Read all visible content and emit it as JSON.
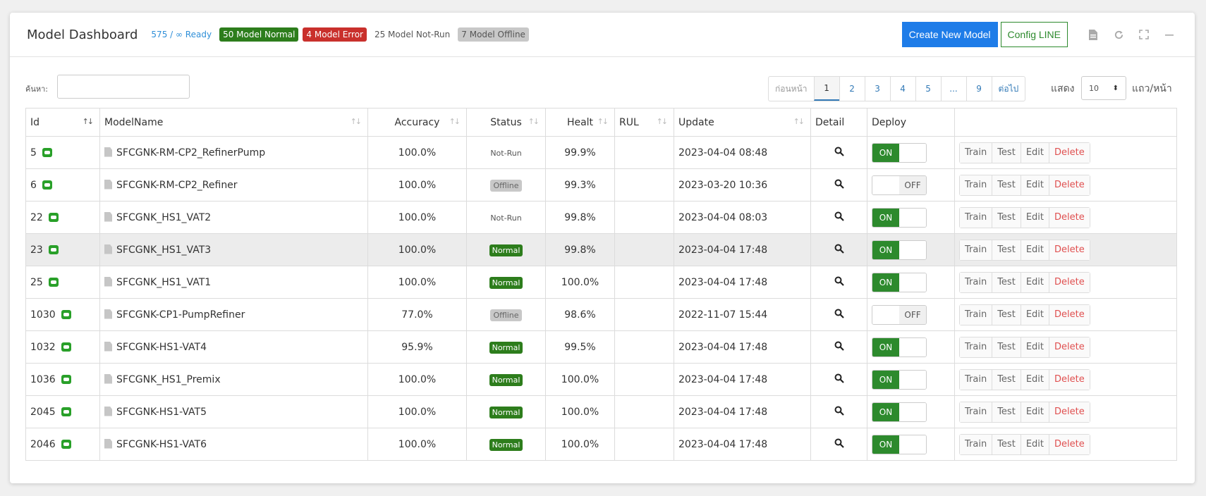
{
  "header": {
    "title": "Model Dashboard",
    "badges": {
      "ready": "575 / ∞ Ready",
      "normal": "50 Model Normal",
      "error": "4 Model Error",
      "notrun": "25 Model Not-Run",
      "offline": "7 Model Offline"
    },
    "create_label": "Create New Model",
    "config_label": "Config LINE"
  },
  "controls": {
    "search_label": "ค้นหา:",
    "search_value": "",
    "pagination": [
      "ก่อนหน้า",
      "1",
      "2",
      "3",
      "4",
      "5",
      "...",
      "9",
      "ต่อไป"
    ],
    "active_page": "1",
    "show_label": "แสดง",
    "per_page": "10",
    "per_page_label": "แถว/หน้า"
  },
  "table": {
    "columns": [
      "Id",
      "ModelName",
      "Accuracy",
      "Status",
      "Healt",
      "RUL",
      "Update",
      "Detail",
      "Deploy",
      ""
    ],
    "action_labels": [
      "Train",
      "Test",
      "Edit",
      "Delete"
    ],
    "toggle_on": "ON",
    "toggle_off": "OFF",
    "rows": [
      {
        "id": "5",
        "name": "SFCGNK-RM-CP2_RefinerPump",
        "accuracy": "100.0%",
        "status": "Not-Run",
        "healt": "99.9%",
        "rul": "",
        "update": "2023-04-04 08:48",
        "deploy": "ON"
      },
      {
        "id": "6",
        "name": "SFCGNK-RM-CP2_Refiner",
        "accuracy": "100.0%",
        "status": "Offline",
        "healt": "99.3%",
        "rul": "",
        "update": "2023-03-20 10:36",
        "deploy": "OFF"
      },
      {
        "id": "22",
        "name": "SFCGNK_HS1_VAT2",
        "accuracy": "100.0%",
        "status": "Not-Run",
        "healt": "99.8%",
        "rul": "",
        "update": "2023-04-04 08:03",
        "deploy": "ON"
      },
      {
        "id": "23",
        "name": "SFCGNK_HS1_VAT3",
        "accuracy": "100.0%",
        "status": "Normal",
        "healt": "99.8%",
        "rul": "",
        "update": "2023-04-04 17:48",
        "deploy": "ON"
      },
      {
        "id": "25",
        "name": "SFCGNK_HS1_VAT1",
        "accuracy": "100.0%",
        "status": "Normal",
        "healt": "100.0%",
        "rul": "",
        "update": "2023-04-04 17:48",
        "deploy": "ON"
      },
      {
        "id": "1030",
        "name": "SFCGNK-CP1-PumpRefiner",
        "accuracy": "77.0%",
        "status": "Offline",
        "healt": "98.6%",
        "rul": "",
        "update": "2022-11-07 15:44",
        "deploy": "OFF"
      },
      {
        "id": "1032",
        "name": "SFCGNK-HS1-VAT4",
        "accuracy": "95.9%",
        "status": "Normal",
        "healt": "99.5%",
        "rul": "",
        "update": "2023-04-04 17:48",
        "deploy": "ON"
      },
      {
        "id": "1036",
        "name": "SFCGNK_HS1_Premix",
        "accuracy": "100.0%",
        "status": "Normal",
        "healt": "100.0%",
        "rul": "",
        "update": "2023-04-04 17:48",
        "deploy": "ON"
      },
      {
        "id": "2045",
        "name": "SFCGNK-HS1-VAT5",
        "accuracy": "100.0%",
        "status": "Normal",
        "healt": "100.0%",
        "rul": "",
        "update": "2023-04-04 17:48",
        "deploy": "ON"
      },
      {
        "id": "2046",
        "name": "SFCGNK-HS1-VAT6",
        "accuracy": "100.0%",
        "status": "Normal",
        "healt": "100.0%",
        "rul": "",
        "update": "2023-04-04 17:48",
        "deploy": "ON"
      }
    ],
    "highlighted_row": 3
  },
  "colors": {
    "primary": "#1e7ce8",
    "success": "#2d7d1c",
    "danger": "#c9302c",
    "muted": "#c8c8c8"
  },
  "icons": {
    "line": "line-chat-icon",
    "file": "file-icon",
    "detail": "search-icon",
    "tools": [
      "export-file-icon",
      "refresh-icon",
      "fullscreen-icon",
      "minimize-icon"
    ]
  }
}
